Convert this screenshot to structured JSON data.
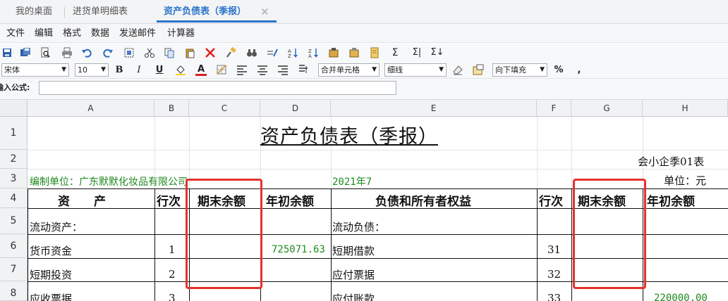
{
  "tabs": [
    {
      "label": "我的桌面"
    },
    {
      "label": "进货单明细表"
    },
    {
      "label": "资产负债表（季报）"
    }
  ],
  "tab_close": "✕",
  "menu": [
    "文件",
    "编辑",
    "格式",
    "数据",
    "发送邮件",
    "计算器"
  ],
  "toolbar": {
    "font_family": "宋体",
    "font_size": "10",
    "bold": "B",
    "italic": "I",
    "underline": "U",
    "font_color": "A",
    "merge_select": "合并单元格",
    "border_select": "细线",
    "fill_select": "向下填充",
    "percent": "%",
    "comma": ","
  },
  "formula": {
    "label": "输入公式:",
    "value": ""
  },
  "columns": [
    "A",
    "B",
    "C",
    "D",
    "E",
    "F",
    "G",
    "H"
  ],
  "rows": [
    "1",
    "2",
    "3",
    "4",
    "5",
    "6",
    "7",
    "8"
  ],
  "sheet": {
    "title": "资产负债表（季报）",
    "form_code": "会小企季01表",
    "unit_label": "编制单位：广东默默化妆品有限公司",
    "period": "2021年7",
    "currency": "单位：元",
    "headers": {
      "assets": "资　　产",
      "line_no": "行次",
      "end_balance": "期末余额",
      "begin_balance": "年初余额",
      "liabilities": "负债和所有者权益",
      "line_no2": "行次",
      "end_balance2": "期末余额",
      "begin_balance2": "年初余额"
    },
    "row5": {
      "a": "流动资产：",
      "e": "流动负债："
    },
    "row6": {
      "a": "货币资金",
      "b": "1",
      "d": "725071.63",
      "e": "短期借款",
      "f": "31"
    },
    "row7": {
      "a": "短期投资",
      "b": "2",
      "e": "应付票据",
      "f": "32"
    },
    "row8": {
      "a": "应收票据",
      "b": "3",
      "e": "应付账款",
      "f": "33",
      "h": "220000.00"
    }
  },
  "colors": {
    "accent": "#2a74c9",
    "highlight": "#e5322d",
    "green_text": "#1e8a1e"
  }
}
